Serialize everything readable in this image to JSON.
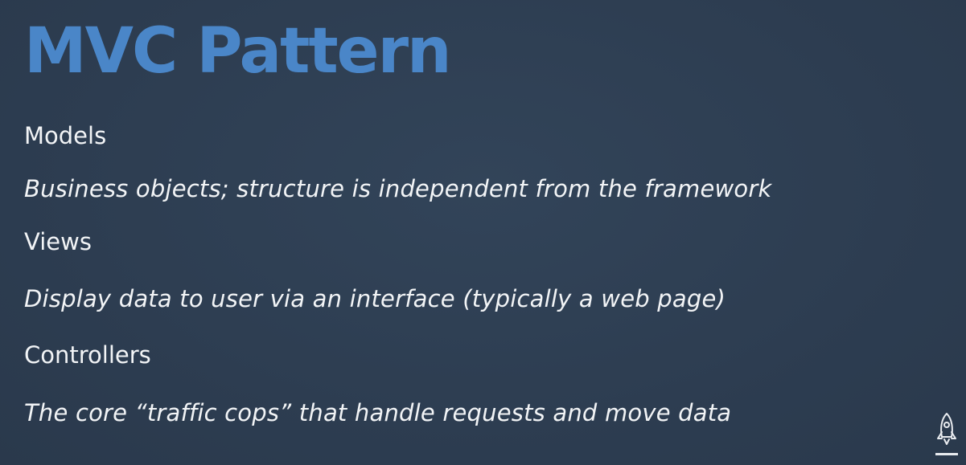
{
  "slide": {
    "title": "MVC Pattern",
    "title_color": "#4a86c8",
    "text_color": "#f2f4f6",
    "background_color": "#2e3e52",
    "items": [
      {
        "heading": "Models",
        "description": "Business objects; structure is independent from the framework"
      },
      {
        "heading": "Views",
        "description": "Display data to user via an interface (typically a web page)"
      },
      {
        "heading": "Controllers",
        "description": "The core “traffic cops” that handle requests and move data"
      }
    ],
    "logo_icon": "rocket-icon"
  }
}
